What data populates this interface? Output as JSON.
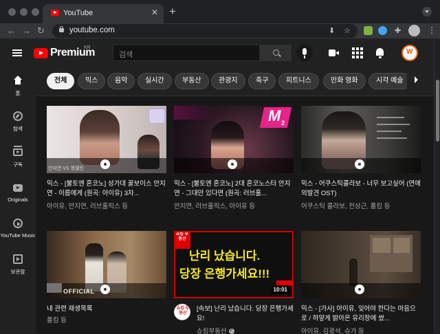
{
  "browser": {
    "tab_title": "YouTube",
    "tab_close": "✕",
    "new_tab": "+",
    "url": "youtube.com"
  },
  "header": {
    "brand": "Premium",
    "country": "KR",
    "search_placeholder": "검색"
  },
  "sidebar": {
    "items": [
      {
        "label": "홈",
        "icon": "home-icon"
      },
      {
        "label": "탐색",
        "icon": "explore-icon"
      },
      {
        "label": "구독",
        "icon": "subscriptions-icon"
      },
      {
        "label": "Originals",
        "icon": "originals-icon"
      },
      {
        "label": "YouTube Music",
        "icon": "music-icon"
      },
      {
        "label": "보관함",
        "icon": "library-icon"
      }
    ]
  },
  "chips": [
    {
      "label": "전체",
      "active": true
    },
    {
      "label": "믹스"
    },
    {
      "label": "음악"
    },
    {
      "label": "실시간"
    },
    {
      "label": "부동산"
    },
    {
      "label": "관광지"
    },
    {
      "label": "축구"
    },
    {
      "label": "피트니스"
    },
    {
      "label": "만화 영화"
    },
    {
      "label": "시각 예술"
    }
  ],
  "videos": [
    {
      "title": "믹스 - [불토엔 혼코노] 성가대 꿀보이스 안지연 - 이름에게 (원곡: 아이유) 3차...",
      "meta": "아이유, 안지연, 러브홀릭스 등"
    },
    {
      "title": "믹스 - [불토엔 혼코노] 2대 혼코노스타 안지연 - 그대만 있다면 (원곡: 러브홀...",
      "meta": "안지연, 러브홀릭스, 아이유 등"
    },
    {
      "title": "믹스 - 어쿠스틱콜라보 - 너무 보고싶어 (연애의발견 OST)",
      "meta": "어쿠스틱 콜라보, 전상근, 폴킴 등"
    },
    {
      "title": "내 관련 재생목록",
      "meta": "폴킴 등"
    },
    {
      "title": "[속보] 난리 났습니다. 당장 은행가세요!",
      "meta": "쇼킹부동산",
      "duration": "10:01",
      "thumb_line1": "난리 났습니다.",
      "thumb_line2": "당장 은행가세요!!!",
      "channel_badge": "쇼킹 부동산"
    },
    {
      "title": "믹스 - [가사] 아이유, 잊어야 한다는 마음으로 / 하얗게 밝아온 유리창에 썼...",
      "meta": "아이유, 김광석, 슈가 등"
    }
  ],
  "thumb_labels": {
    "v1_caption": "안지연 VS 엔젤린",
    "v2_logo": "M",
    "v2_sub": "2",
    "v4_tag": "OFFICIAL"
  }
}
